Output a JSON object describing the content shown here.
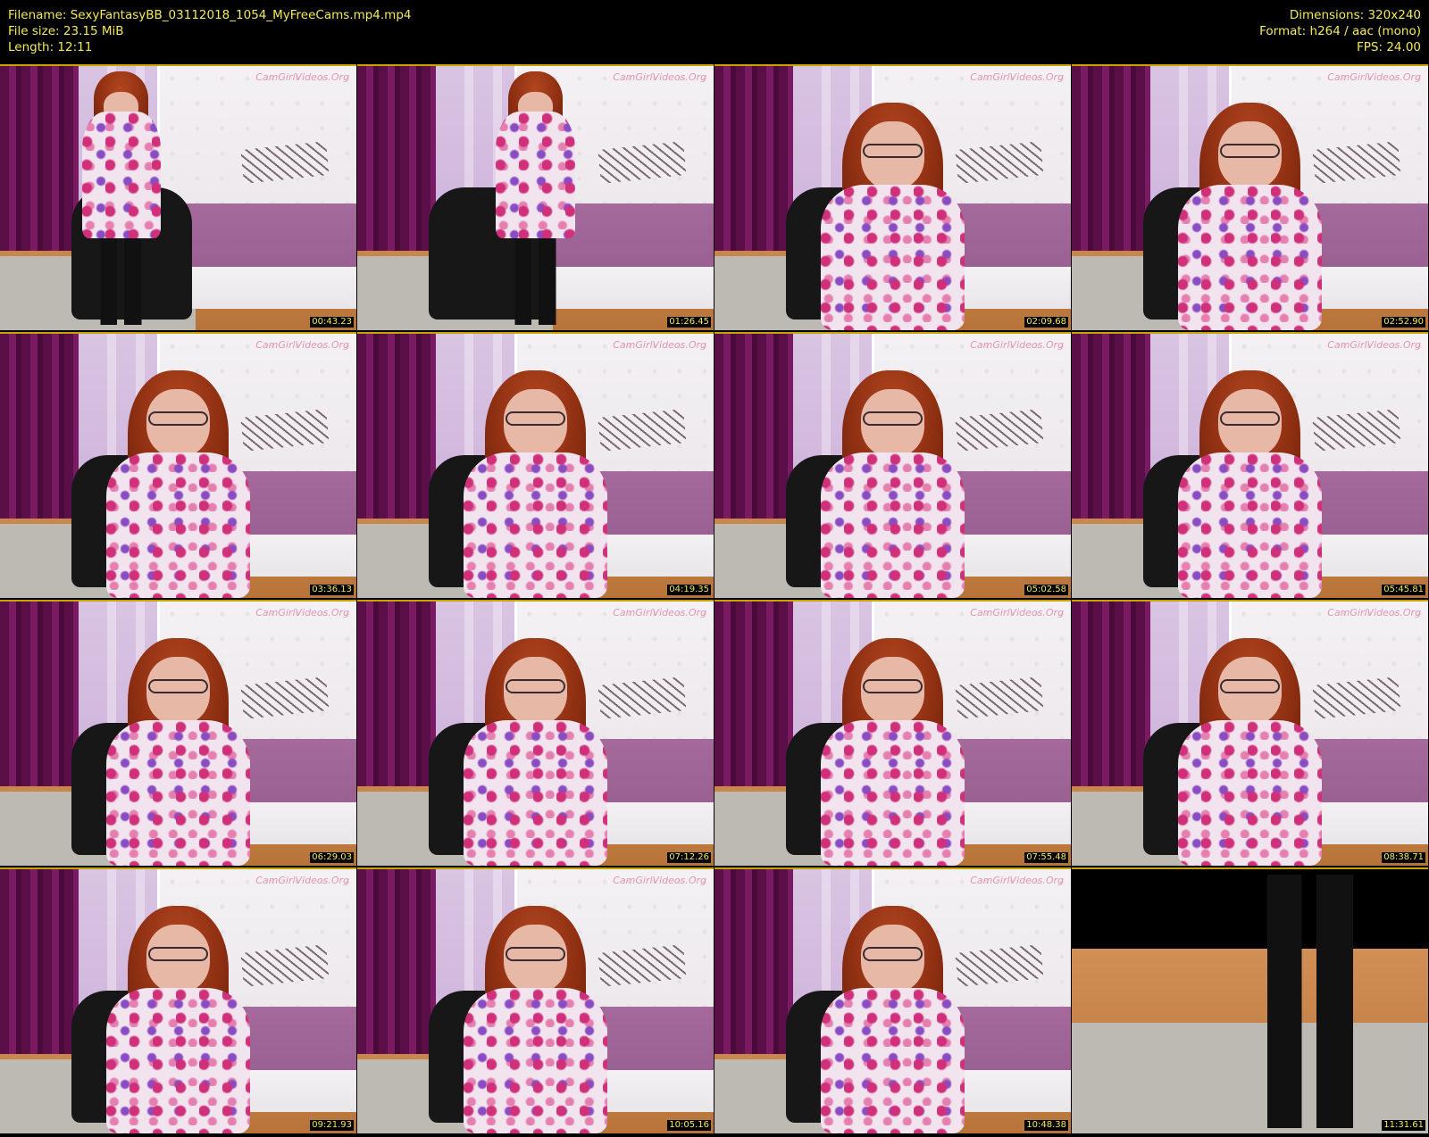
{
  "header": {
    "filename": "Filename: SexyFantasyBB_03112018_1054_MyFreeCams.mp4.mp4",
    "file_size": "File size: 23.15 MiB",
    "length": "Length: 12:11",
    "dimensions": "Dimensions: 320x240",
    "format": "Format: h264 / aac (mono)",
    "fps": "FPS: 24.00"
  },
  "watermark": "CamGirlVideos.Org",
  "thumbnails": [
    {
      "time": "00:43.23"
    },
    {
      "time": "01:26.45"
    },
    {
      "time": "02:09.68"
    },
    {
      "time": "02:52.90"
    },
    {
      "time": "03:36.13"
    },
    {
      "time": "04:19.35"
    },
    {
      "time": "05:02.58"
    },
    {
      "time": "05:45.81"
    },
    {
      "time": "06:29.03"
    },
    {
      "time": "07:12.26"
    },
    {
      "time": "07:55.48"
    },
    {
      "time": "08:38.71"
    },
    {
      "time": "09:21.93"
    },
    {
      "time": "10:05.16"
    },
    {
      "time": "10:48.38"
    },
    {
      "time": "11:31.61"
    }
  ],
  "colors": {
    "text": "#f2e95a",
    "background": "#000000",
    "thumb_border": "#c9a300"
  }
}
